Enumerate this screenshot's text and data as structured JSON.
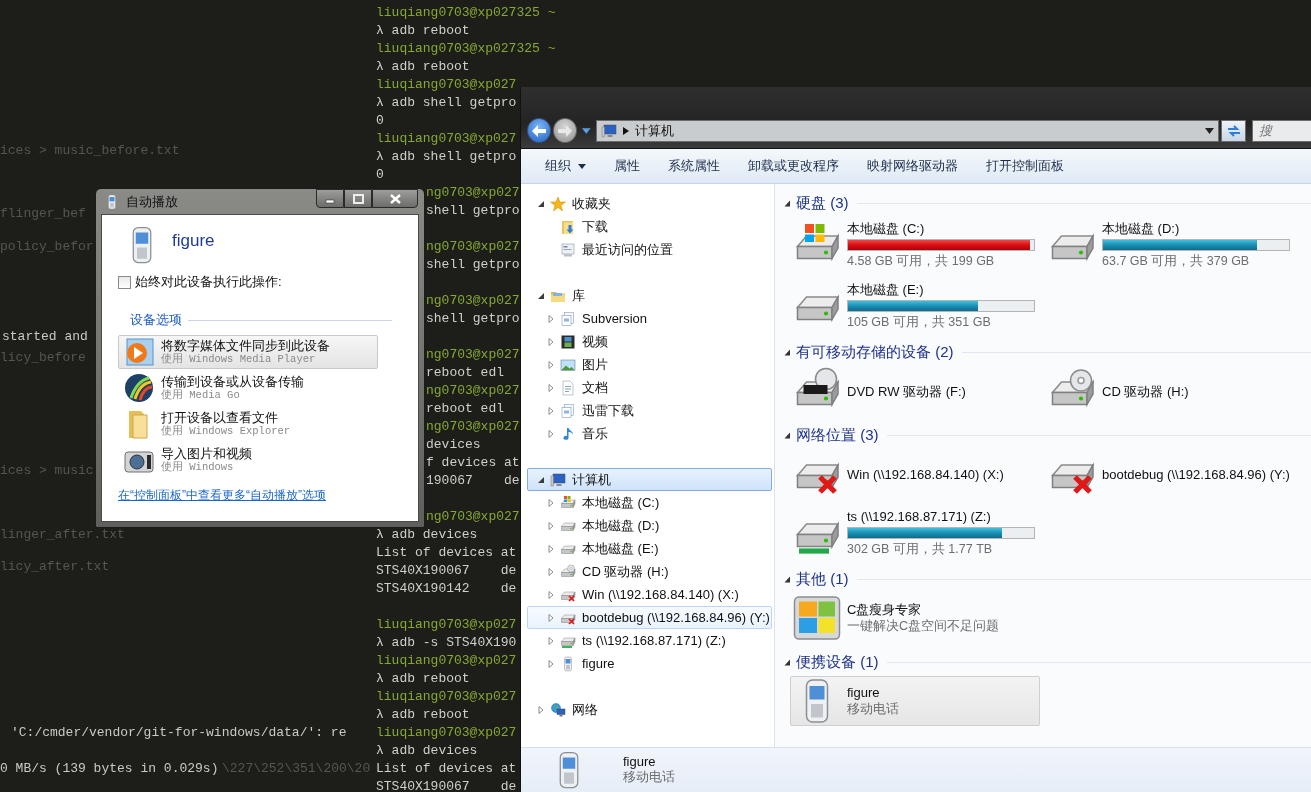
{
  "terminal_left": {
    "lines": [
      {
        "kind": "dim",
        "text": "ices > music_before.txt"
      },
      {
        "kind": "dim",
        "text": "flinger_bef"
      },
      {
        "kind": "dim",
        "text": "policy_befor"
      },
      {
        "kind": "bright",
        "text": "started and"
      },
      {
        "kind": "dim",
        "text": "licy_before"
      },
      {
        "kind": "dim",
        "text": "ices > music"
      },
      {
        "kind": "dim",
        "text": "linger_after.txt"
      },
      {
        "kind": "dim",
        "text": "licy_after.txt"
      },
      {
        "kind": "bright",
        "text": "'C:/cmder/vendor/git-for-windows/data/': re"
      },
      {
        "kind": "bright",
        "text": "0 MB/s (139 bytes in 0.029s)"
      },
      {
        "kind": "dim",
        "text": "\\227\\252\\351\\200\\20"
      }
    ]
  },
  "terminal": {
    "lines": [
      {
        "kind": "prompt",
        "text": "liuqiang0703@xp027325 ~"
      },
      {
        "kind": "command",
        "text": "λ adb reboot"
      },
      {
        "kind": "prompt",
        "text": "liuqiang0703@xp027325 ~"
      },
      {
        "kind": "command",
        "text": "λ adb reboot"
      },
      {
        "kind": "prompt",
        "text": "liuqiang0703@xp027"
      },
      {
        "kind": "command",
        "text": "λ adb shell getpro"
      },
      {
        "kind": "command",
        "text": "0"
      },
      {
        "kind": "prompt",
        "text": "liuqiang0703@xp027"
      },
      {
        "kind": "command",
        "text": "λ adb shell getpro"
      },
      {
        "kind": "command",
        "text": "0"
      },
      {
        "kind": "prompt-tail",
        "text": "ng0703@xp027"
      },
      {
        "kind": "command-tail",
        "text": "shell getpro"
      },
      {
        "kind": "blank"
      },
      {
        "kind": "prompt-tail",
        "text": "ng0703@xp027"
      },
      {
        "kind": "command-tail",
        "text": "shell getpro"
      },
      {
        "kind": "blank"
      },
      {
        "kind": "prompt-tail",
        "text": "ng0703@xp027"
      },
      {
        "kind": "command-tail",
        "text": "shell getpro"
      },
      {
        "kind": "blank"
      },
      {
        "kind": "prompt-tail",
        "text": "ng0703@xp027"
      },
      {
        "kind": "command-tail",
        "text": "reboot edl"
      },
      {
        "kind": "prompt-tail",
        "text": "ng0703@xp027"
      },
      {
        "kind": "command-tail",
        "text": "reboot edl"
      },
      {
        "kind": "prompt-tail",
        "text": "ng0703@xp027"
      },
      {
        "kind": "command-tail",
        "text": "devices"
      },
      {
        "kind": "command-tail",
        "text": "f devices at"
      },
      {
        "kind": "command-tail",
        "text": "190067    de"
      },
      {
        "kind": "blank"
      },
      {
        "kind": "prompt-tail",
        "text": "ng0703@xp027"
      },
      {
        "kind": "command",
        "text": "λ adb devices"
      },
      {
        "kind": "command",
        "text": "List of devices at"
      },
      {
        "kind": "command",
        "text": "STS40X190067    de"
      },
      {
        "kind": "command",
        "text": "STS40X190142    de"
      },
      {
        "kind": "blank"
      },
      {
        "kind": "prompt",
        "text": "liuqiang0703@xp027"
      },
      {
        "kind": "command",
        "text": "λ adb -s STS40X190"
      },
      {
        "kind": "prompt",
        "text": "liuqiang0703@xp027"
      },
      {
        "kind": "command",
        "text": "λ adb reboot"
      },
      {
        "kind": "prompt",
        "text": "liuqiang0703@xp027"
      },
      {
        "kind": "command",
        "text": "λ adb reboot"
      },
      {
        "kind": "prompt",
        "text": "liuqiang0703@xp027"
      },
      {
        "kind": "command",
        "text": "λ adb devices"
      },
      {
        "kind": "command",
        "text": "List of devices at"
      },
      {
        "kind": "command",
        "text": "STS40X190067    de"
      }
    ]
  },
  "autoplay": {
    "title": "自动播放",
    "device": "figure",
    "always_label": "始终对此设备执行此操作:",
    "always_checked": false,
    "section": "设备选项",
    "options": [
      {
        "kind": "media-player",
        "title": "将数字媒体文件同步到此设备",
        "subtitle": "使用 Windows Media Player",
        "highlighted": true
      },
      {
        "kind": "media-go",
        "title": "传输到设备或从设备传输",
        "subtitle": "使用 Media Go",
        "highlighted": false
      },
      {
        "kind": "explorer",
        "title": "打开设备以查看文件",
        "subtitle": "使用 Windows Explorer",
        "highlighted": false
      },
      {
        "kind": "camera",
        "title": "导入图片和视频",
        "subtitle": "使用 Windows",
        "highlighted": false
      }
    ],
    "link": "在“控制面板”中查看更多“自动播放”选项"
  },
  "explorer": {
    "address": "计算机",
    "search_placeholder": "搜",
    "toolbar": [
      {
        "label": "组织",
        "menu": true
      },
      {
        "label": "属性",
        "menu": false
      },
      {
        "label": "系统属性",
        "menu": false
      },
      {
        "label": "卸载或更改程序",
        "menu": false
      },
      {
        "label": "映射网络驱动器",
        "menu": false
      },
      {
        "label": "打开控制面板",
        "menu": false
      }
    ],
    "nav_tree": [
      {
        "label": "收藏夹",
        "kind": "star",
        "expanded": true,
        "selected": false,
        "hovered": false,
        "children": [
          {
            "label": "下载",
            "kind": "download-folder",
            "selected": false,
            "hovered": false
          },
          {
            "label": "最近访问的位置",
            "kind": "recent",
            "selected": false,
            "hovered": false
          }
        ]
      },
      {
        "label": "库",
        "kind": "library",
        "expanded": true,
        "selected": false,
        "hovered": false,
        "children": [
          {
            "label": "Subversion",
            "kind": "svn",
            "expanded": false,
            "selected": false,
            "hovered": false
          },
          {
            "label": "视频",
            "kind": "video",
            "expanded": false,
            "selected": false,
            "hovered": false
          },
          {
            "label": "图片",
            "kind": "picture",
            "expanded": false,
            "selected": false,
            "hovered": false
          },
          {
            "label": "文档",
            "kind": "document",
            "expanded": false,
            "selected": false,
            "hovered": false
          },
          {
            "label": "迅雷下载",
            "kind": "svn",
            "expanded": false,
            "selected": false,
            "hovered": false
          },
          {
            "label": "音乐",
            "kind": "music",
            "expanded": false,
            "selected": false,
            "hovered": false
          }
        ]
      },
      {
        "label": "计算机",
        "kind": "computer",
        "expanded": true,
        "selected": true,
        "hovered": false,
        "children": [
          {
            "label": "本地磁盘 (C:)",
            "kind": "system-disk",
            "expanded": false,
            "selected": false,
            "hovered": false
          },
          {
            "label": "本地磁盘 (D:)",
            "kind": "small-disk",
            "expanded": false,
            "selected": false,
            "hovered": false
          },
          {
            "label": "本地磁盘 (E:)",
            "kind": "small-disk",
            "expanded": false,
            "selected": false,
            "hovered": false
          },
          {
            "label": "CD 驱动器 (H:)",
            "kind": "cd",
            "expanded": false,
            "selected": false,
            "hovered": false
          },
          {
            "label": "Win (\\\\192.168.84.140) (X:)",
            "kind": "net-offline",
            "expanded": false,
            "selected": false,
            "hovered": false
          },
          {
            "label": "bootdebug (\\\\192.168.84.96) (Y:)",
            "kind": "net-offline",
            "expanded": false,
            "selected": false,
            "hovered": true
          },
          {
            "label": "ts (\\\\192.168.87.171) (Z:)",
            "kind": "net-disk",
            "expanded": false,
            "selected": false,
            "hovered": false
          },
          {
            "label": "figure",
            "kind": "phone",
            "expanded": false,
            "selected": false,
            "hovered": false
          }
        ]
      },
      {
        "label": "网络",
        "kind": "network",
        "expanded": false,
        "selected": false,
        "hovered": false
      }
    ],
    "groups": [
      {
        "title": "硬盘 (3)",
        "expanded": true,
        "items": [
          {
            "kind": "system-disk",
            "name": "本地磁盘 (C:)",
            "level": 0.98,
            "warning": true,
            "space": "4.58 GB 可用，共 199 GB"
          },
          {
            "kind": "disk",
            "name": "本地磁盘 (D:)",
            "level": 0.83,
            "warning": false,
            "space": "63.7 GB 可用，共 379 GB"
          },
          {
            "kind": "disk",
            "name": "本地磁盘 (E:)",
            "level": 0.7,
            "warning": false,
            "space": "105 GB 可用，共 351 GB"
          }
        ]
      },
      {
        "title": "有可移动存储的设备 (2)",
        "expanded": true,
        "items": [
          {
            "kind": "dvd",
            "name": "DVD RW 驱动器 (F:)"
          },
          {
            "kind": "cd",
            "name": "CD 驱动器 (H:)"
          }
        ]
      },
      {
        "title": "网络位置 (3)",
        "expanded": true,
        "items": [
          {
            "kind": "net-offline",
            "name": "Win (\\\\192.168.84.140) (X:)"
          },
          {
            "kind": "net-offline",
            "name": "bootdebug (\\\\192.168.84.96) (Y:)"
          },
          {
            "kind": "net-disk",
            "name": "ts (\\\\192.168.87.171) (Z:)",
            "level": 0.83,
            "warning": false,
            "space": "302 GB 可用，共 1.77 TB"
          }
        ]
      },
      {
        "title": "其他 (1)",
        "expanded": true,
        "items": [
          {
            "kind": "app",
            "name": "C盘瘦身专家",
            "space": "一键解决C盘空间不足问题"
          }
        ]
      },
      {
        "title": "便携设备 (1)",
        "expanded": true,
        "items": [
          {
            "kind": "device",
            "name": "figure",
            "space": "移动电话",
            "selected": true
          }
        ]
      }
    ],
    "details": {
      "name": "figure",
      "type": "移动电话"
    }
  }
}
